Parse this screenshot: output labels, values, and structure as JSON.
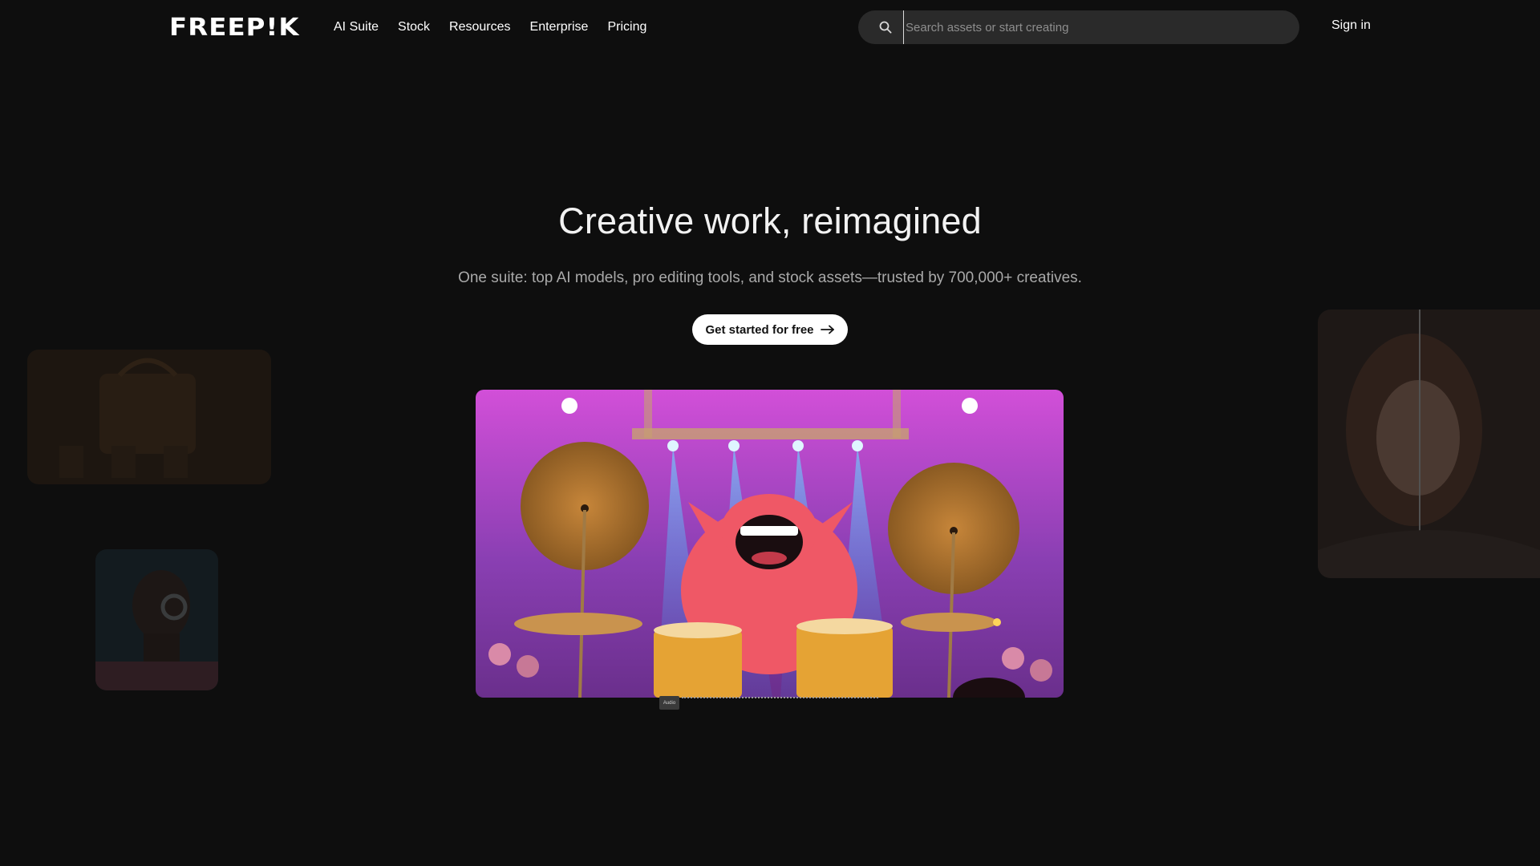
{
  "brand": {
    "logo_text": "FREEP!K"
  },
  "nav": {
    "items": [
      {
        "label": "AI Suite"
      },
      {
        "label": "Stock"
      },
      {
        "label": "Resources"
      },
      {
        "label": "Enterprise"
      },
      {
        "label": "Pricing"
      }
    ]
  },
  "search": {
    "placeholder": "Search assets or start creating",
    "value": "",
    "icon": "search-icon"
  },
  "account": {
    "signin_label": "Sign in"
  },
  "hero": {
    "title": "Creative work, reimagined",
    "subtitle": "One suite: top AI models, pro editing tools, and stock assets—trusted by 700,000+ creatives.",
    "cta_label": "Get started for free",
    "cta_icon": "arrow-right-icon"
  },
  "video": {
    "audio_label": "Audio"
  },
  "colors": {
    "background": "#0e0e0e",
    "search_bg": "#2a2a2a",
    "cta_bg": "#ffffff",
    "text_muted": "#a9a9a9"
  }
}
